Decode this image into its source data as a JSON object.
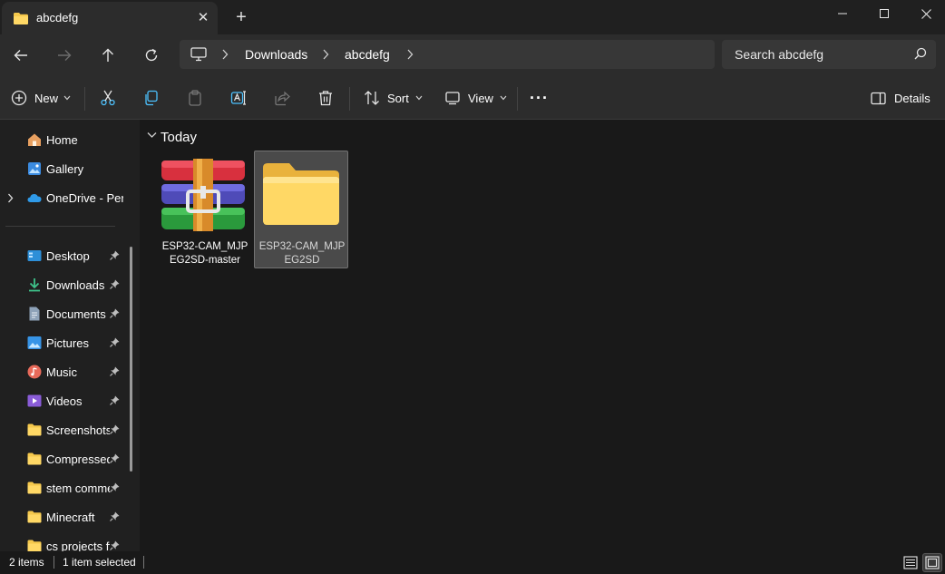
{
  "tab": {
    "title": "abcdefg",
    "close_glyph": "✕",
    "add_glyph": "+"
  },
  "window": {
    "minimize": "—",
    "maximize": "☐",
    "close": "✕"
  },
  "address": {
    "segments": [
      "Downloads",
      "abcdefg"
    ],
    "search_placeholder": "Search abcdefg"
  },
  "commands": {
    "new_label": "New",
    "sort_label": "Sort",
    "view_label": "View",
    "more_label": "···",
    "details_label": "Details"
  },
  "sidebar": {
    "top_items": [
      {
        "label": "Home",
        "icon": "home-icon"
      },
      {
        "label": "Gallery",
        "icon": "gallery-icon"
      },
      {
        "label": "OneDrive - Perso",
        "icon": "onedrive-icon"
      }
    ],
    "pinned_items": [
      {
        "label": "Desktop",
        "icon": "desktop-icon"
      },
      {
        "label": "Downloads",
        "icon": "download-icon"
      },
      {
        "label": "Documents",
        "icon": "documents-icon"
      },
      {
        "label": "Pictures",
        "icon": "pictures-icon"
      },
      {
        "label": "Music",
        "icon": "music-icon"
      },
      {
        "label": "Videos",
        "icon": "videos-icon"
      },
      {
        "label": "Screenshots",
        "icon": "folder-icon"
      },
      {
        "label": "Compressed",
        "icon": "folder-icon"
      },
      {
        "label": "stem comme",
        "icon": "folder-icon"
      },
      {
        "label": "Minecraft",
        "icon": "folder-icon"
      },
      {
        "label": "cs projects ff",
        "icon": "folder-icon"
      }
    ]
  },
  "content": {
    "group_title": "Today",
    "files": [
      {
        "name": "ESP32-CAM_MJPEG2SD-master",
        "type": "archive",
        "selected": false
      },
      {
        "name": "ESP32-CAM_MJPEG2SD",
        "type": "folder",
        "selected": true
      }
    ]
  },
  "status": {
    "count": "2 items",
    "selection": "1 item selected"
  },
  "colors": {
    "folder": "#f5c84c",
    "accent_blue": "#4cc2ff",
    "selected_bg": "#4a4a4a"
  }
}
